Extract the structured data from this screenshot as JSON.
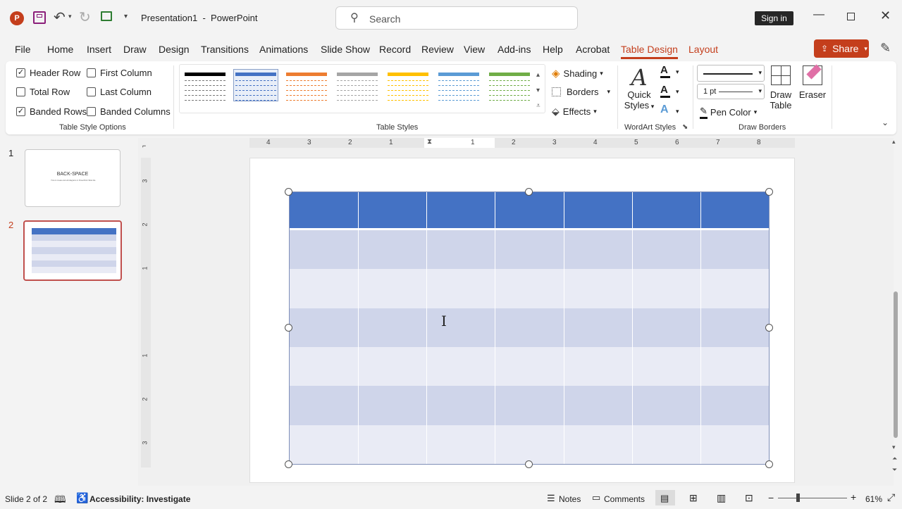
{
  "app": {
    "doc_title": "Presentation1",
    "separator": "-",
    "app_name": "PowerPoint",
    "search_placeholder": "Search",
    "sign_in": "Sign in"
  },
  "tabs": [
    {
      "label": "File"
    },
    {
      "label": "Home"
    },
    {
      "label": "Insert"
    },
    {
      "label": "Draw"
    },
    {
      "label": "Design"
    },
    {
      "label": "Transitions"
    },
    {
      "label": "Animations"
    },
    {
      "label": "Slide Show"
    },
    {
      "label": "Record"
    },
    {
      "label": "Review"
    },
    {
      "label": "View"
    },
    {
      "label": "Add-ins"
    },
    {
      "label": "Help"
    },
    {
      "label": "Acrobat"
    },
    {
      "label": "Table Design"
    },
    {
      "label": "Layout"
    }
  ],
  "share": {
    "label": "Share"
  },
  "table_style_options": {
    "header_row": "Header Row",
    "header_row_checked": true,
    "total_row": "Total Row",
    "total_row_checked": false,
    "banded_rows": "Banded Rows",
    "banded_rows_checked": true,
    "first_column": "First Column",
    "first_column_checked": false,
    "last_column": "Last Column",
    "last_column_checked": false,
    "banded_columns": "Banded Columns",
    "banded_columns_checked": false,
    "group_label": "Table Style Options"
  },
  "table_styles": {
    "group_label": "Table Styles",
    "colors": [
      "#000000",
      "#4472c4",
      "#ed7d31",
      "#a5a5a5",
      "#ffc000",
      "#5b9bd5",
      "#70ad47"
    ],
    "shading": "Shading",
    "borders": "Borders",
    "effects": "Effects"
  },
  "wordart": {
    "quick_styles_line1": "Quick",
    "quick_styles_line2": "Styles",
    "group_label": "WordArt Styles"
  },
  "draw_borders": {
    "pen_weight": "1 pt",
    "pen_color": "Pen Color",
    "draw_table_line1": "Draw",
    "draw_table_line2": "Table",
    "eraser": "Eraser",
    "group_label": "Draw Borders"
  },
  "ruler_numbers": [
    "4",
    "3",
    "2",
    "1",
    "1",
    "2",
    "3",
    "4",
    "5",
    "6",
    "7",
    "8"
  ],
  "vruler_numbers": [
    "3",
    "2",
    "1",
    "1",
    "2",
    "3"
  ],
  "slides": [
    {
      "number": "1",
      "title": "BACK-SPACE",
      "subtitle": "How to create and edit diagrams in PowerPoint Slide title"
    },
    {
      "number": "2"
    }
  ],
  "table": {
    "header_color": "#4472c4",
    "band_dark": "#cfd5ea",
    "band_light": "#e9ebf5",
    "columns": 7,
    "body_rows": 6
  },
  "status": {
    "slide_info": "Slide 2 of 2",
    "accessibility": "Accessibility: Investigate",
    "notes": "Notes",
    "comments": "Comments",
    "zoom": "61%"
  }
}
